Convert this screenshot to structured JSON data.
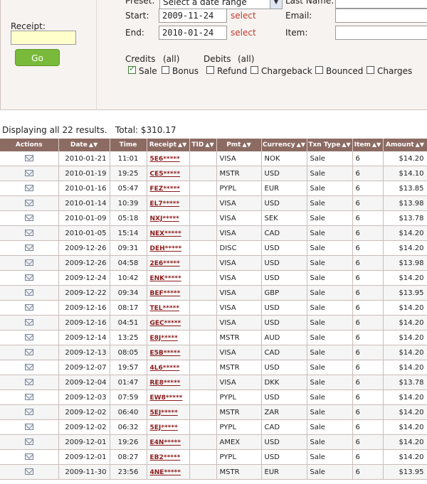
{
  "filters": {
    "preset_label": "Preset:",
    "preset_value": "Select a date range",
    "start_label": "Start:",
    "start_value": "2009-11-24",
    "end_label": "End:",
    "end_value": "2010-01-24",
    "select_link": "select",
    "last_name_label": "Last Name:",
    "email_label": "Email:",
    "item_label": "Item:",
    "receipt_label": "Receipt:",
    "go_label": "Go",
    "credits_label": "Credits",
    "credits_all": "(all)",
    "debits_label": "Debits",
    "debits_all": "(all)",
    "checkboxes": [
      {
        "label": "Sale",
        "checked": true
      },
      {
        "label": "Bonus",
        "checked": false
      },
      {
        "label": "Refund",
        "checked": false
      },
      {
        "label": "Chargeback",
        "checked": false
      },
      {
        "label": "Bounced",
        "checked": false
      },
      {
        "label": "Charges",
        "checked": false
      }
    ]
  },
  "summary": {
    "displaying": "Displaying all 22 results.",
    "total": "Total: $310.17"
  },
  "table": {
    "columns": [
      "Actions",
      "Date",
      "Time",
      "Receipt",
      "TID",
      "Pmt",
      "Currency",
      "Txn Type",
      "Item",
      "Amount"
    ],
    "rows": [
      {
        "date": "2010-01-21",
        "time": "11:01",
        "receipt": "5E6*****",
        "tid": "",
        "pmt": "VISA",
        "currency": "NOK",
        "txn": "Sale",
        "item": "6",
        "amount": "$14.20"
      },
      {
        "date": "2010-01-19",
        "time": "19:25",
        "receipt": "CE5*****",
        "tid": "",
        "pmt": "MSTR",
        "currency": "USD",
        "txn": "Sale",
        "item": "6",
        "amount": "$14.10"
      },
      {
        "date": "2010-01-16",
        "time": "05:47",
        "receipt": "FEZ*****",
        "tid": "",
        "pmt": "PYPL",
        "currency": "EUR",
        "txn": "Sale",
        "item": "6",
        "amount": "$13.85"
      },
      {
        "date": "2010-01-14",
        "time": "10:39",
        "receipt": "EL7*****",
        "tid": "",
        "pmt": "VISA",
        "currency": "USD",
        "txn": "Sale",
        "item": "6",
        "amount": "$13.98"
      },
      {
        "date": "2010-01-09",
        "time": "05:18",
        "receipt": "NXJ*****",
        "tid": "",
        "pmt": "VISA",
        "currency": "SEK",
        "txn": "Sale",
        "item": "6",
        "amount": "$13.78"
      },
      {
        "date": "2010-01-05",
        "time": "15:14",
        "receipt": "NEX*****",
        "tid": "",
        "pmt": "VISA",
        "currency": "CAD",
        "txn": "Sale",
        "item": "6",
        "amount": "$14.20"
      },
      {
        "date": "2009-12-26",
        "time": "09:31",
        "receipt": "DEH*****",
        "tid": "",
        "pmt": "DISC",
        "currency": "USD",
        "txn": "Sale",
        "item": "6",
        "amount": "$14.20"
      },
      {
        "date": "2009-12-26",
        "time": "04:58",
        "receipt": "2E6*****",
        "tid": "",
        "pmt": "VISA",
        "currency": "USD",
        "txn": "Sale",
        "item": "6",
        "amount": "$13.98"
      },
      {
        "date": "2009-12-24",
        "time": "10:42",
        "receipt": "ENK*****",
        "tid": "",
        "pmt": "VISA",
        "currency": "USD",
        "txn": "Sale",
        "item": "6",
        "amount": "$14.20"
      },
      {
        "date": "2009-12-22",
        "time": "09:34",
        "receipt": "BEF*****",
        "tid": "",
        "pmt": "VISA",
        "currency": "GBP",
        "txn": "Sale",
        "item": "6",
        "amount": "$13.95"
      },
      {
        "date": "2009-12-16",
        "time": "08:17",
        "receipt": "TEL*****",
        "tid": "",
        "pmt": "VISA",
        "currency": "USD",
        "txn": "Sale",
        "item": "6",
        "amount": "$14.20"
      },
      {
        "date": "2009-12-16",
        "time": "04:51",
        "receipt": "GEC*****",
        "tid": "",
        "pmt": "VISA",
        "currency": "USD",
        "txn": "Sale",
        "item": "6",
        "amount": "$14.20"
      },
      {
        "date": "2009-12-14",
        "time": "13:25",
        "receipt": "E8J*****",
        "tid": "",
        "pmt": "MSTR",
        "currency": "AUD",
        "txn": "Sale",
        "item": "6",
        "amount": "$14.20"
      },
      {
        "date": "2009-12-13",
        "time": "08:05",
        "receipt": "E5B*****",
        "tid": "",
        "pmt": "VISA",
        "currency": "CAD",
        "txn": "Sale",
        "item": "6",
        "amount": "$14.20"
      },
      {
        "date": "2009-12-07",
        "time": "19:57",
        "receipt": "4L6*****",
        "tid": "",
        "pmt": "MSTR",
        "currency": "USD",
        "txn": "Sale",
        "item": "6",
        "amount": "$14.20"
      },
      {
        "date": "2009-12-04",
        "time": "01:47",
        "receipt": "RE8*****",
        "tid": "",
        "pmt": "VISA",
        "currency": "DKK",
        "txn": "Sale",
        "item": "6",
        "amount": "$13.78"
      },
      {
        "date": "2009-12-03",
        "time": "07:59",
        "receipt": "EW8*****",
        "tid": "",
        "pmt": "PYPL",
        "currency": "USD",
        "txn": "Sale",
        "item": "6",
        "amount": "$14.20"
      },
      {
        "date": "2009-12-02",
        "time": "06:40",
        "receipt": "5EJ*****",
        "tid": "",
        "pmt": "MSTR",
        "currency": "ZAR",
        "txn": "Sale",
        "item": "6",
        "amount": "$14.20"
      },
      {
        "date": "2009-12-02",
        "time": "06:32",
        "receipt": "5EJ*****",
        "tid": "",
        "pmt": "PYPL",
        "currency": "CAD",
        "txn": "Sale",
        "item": "6",
        "amount": "$14.20"
      },
      {
        "date": "2009-12-01",
        "time": "19:26",
        "receipt": "E4N*****",
        "tid": "",
        "pmt": "AMEX",
        "currency": "USD",
        "txn": "Sale",
        "item": "6",
        "amount": "$14.20"
      },
      {
        "date": "2009-12-01",
        "time": "08:27",
        "receipt": "EB2*****",
        "tid": "",
        "pmt": "PYPL",
        "currency": "USD",
        "txn": "Sale",
        "item": "6",
        "amount": "$14.20"
      },
      {
        "date": "2009-11-30",
        "time": "23:56",
        "receipt": "4NE*****",
        "tid": "",
        "pmt": "MSTR",
        "currency": "EUR",
        "txn": "Sale",
        "item": "6",
        "amount": "$13.95"
      }
    ]
  }
}
